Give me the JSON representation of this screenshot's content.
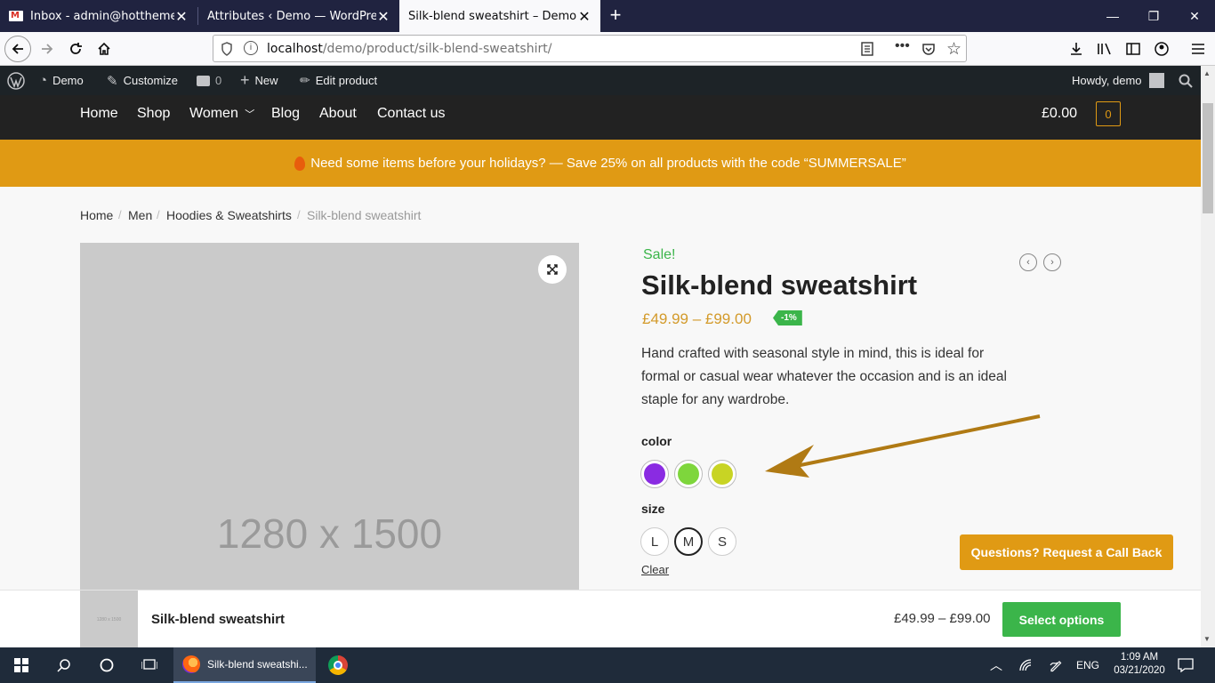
{
  "browser": {
    "tabs": [
      {
        "title": "Inbox - admin@hottheme.net",
        "active": false
      },
      {
        "title": "Attributes ‹ Demo — WordPress",
        "active": false
      },
      {
        "title": "Silk-blend sweatshirt – Demo",
        "active": true
      }
    ],
    "url_host": "localhost",
    "url_path": "/demo/product/silk-blend-sweatshirt/"
  },
  "wp_admin": {
    "site": "Demo",
    "customize": "Customize",
    "comments": "0",
    "new": "New",
    "edit": "Edit product",
    "howdy": "Howdy, demo"
  },
  "site_nav": {
    "items": [
      "Home",
      "Shop",
      "Women",
      "Blog",
      "About",
      "Contact us"
    ],
    "cart_total": "£0.00",
    "cart_count": "0"
  },
  "promo": "Need some items before your holidays? — Save 25% on all products with the code “SUMMERSALE”",
  "breadcrumb": [
    "Home",
    "Men",
    "Hoodies & Sweatshirts",
    "Silk-blend sweatshirt"
  ],
  "product": {
    "placeholder": "1280 x 1500",
    "sale": "Sale!",
    "title": "Silk-blend sweatshirt",
    "price": "£49.99 – £99.00",
    "badge": "-1%",
    "description": "Hand crafted with seasonal style in mind, this is ideal for formal or casual wear whatever the occasion and is an ideal staple for any wardrobe.",
    "color_label": "color",
    "colors": [
      "#8a2be2",
      "#7ed63c",
      "#c8d424"
    ],
    "size_label": "size",
    "sizes": [
      "L",
      "M",
      "S"
    ],
    "selected_size": "M",
    "clear": "Clear"
  },
  "callback": "Questions? Request a Call Back",
  "sticky": {
    "thumb": "1280 x 1500",
    "title": "Silk-blend sweatshirt",
    "price": "£49.99 – £99.00",
    "button": "Select options"
  },
  "taskbar": {
    "app": "Silk-blend sweatshi...",
    "lang": "ENG",
    "time": "1:09 AM",
    "date": "03/21/2020"
  },
  "colors": {
    "accent": "#e09a14",
    "green": "#3bb54a",
    "arrow": "#b07a14"
  }
}
